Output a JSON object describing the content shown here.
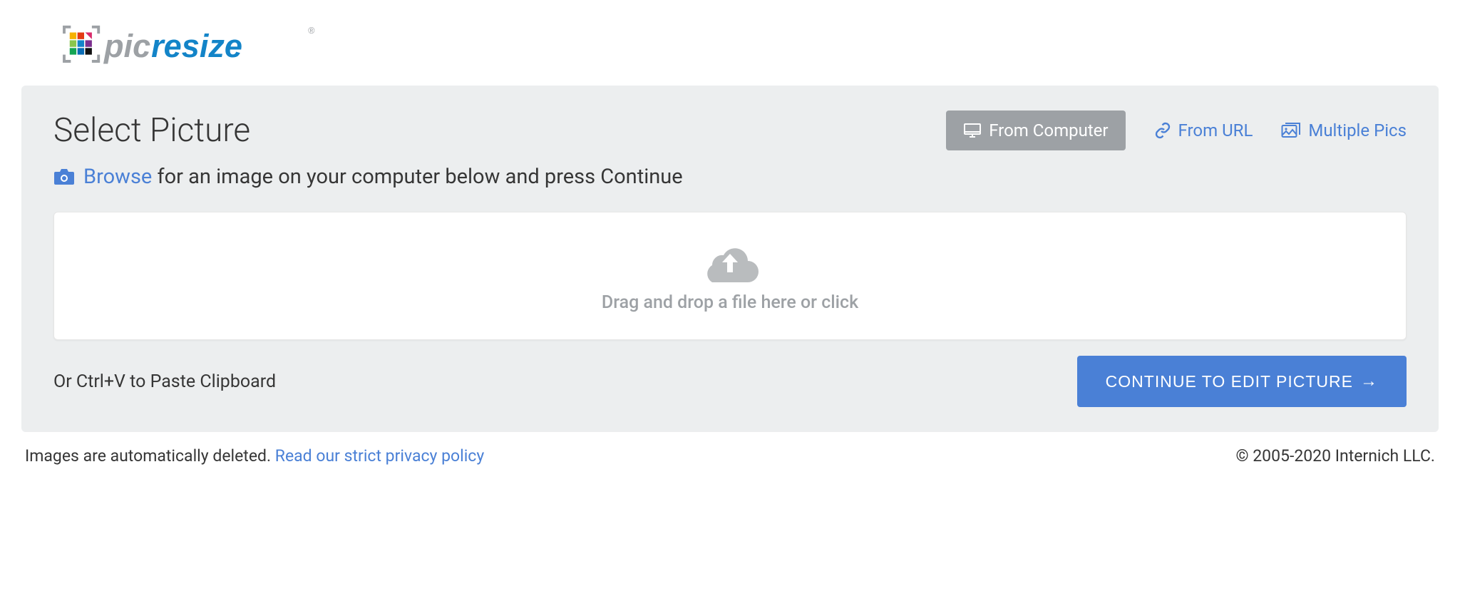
{
  "logo": {
    "prefix_text": "pic",
    "main_text": "resize"
  },
  "panel": {
    "title": "Select Picture",
    "tabs": {
      "from_computer": "From Computer",
      "from_url": "From URL",
      "multiple_pics": "Multiple Pics"
    },
    "instruction": {
      "browse": "Browse",
      "rest": "for an image on your computer below and press Continue"
    },
    "dropzone_text": "Drag and drop a file here or click",
    "paste_hint": "Or Ctrl+V to Paste Clipboard",
    "continue_label": "CONTINUE TO EDIT PICTURE"
  },
  "footer": {
    "delete_text": "Images are automatically deleted.",
    "privacy_link": "Read our strict privacy policy",
    "copyright": "© 2005-2020 Internich LLC."
  }
}
